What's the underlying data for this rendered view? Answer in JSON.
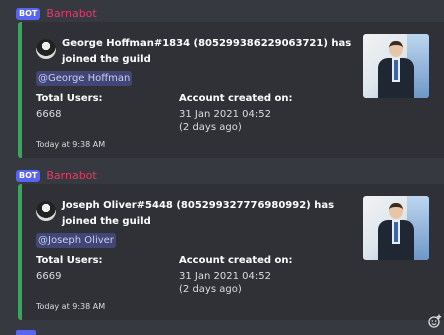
{
  "messages": [
    {
      "bot_tag": "BOT",
      "author": "Barnabot",
      "embed": {
        "title": "George Hoffman#1834 (805299386229063721) has joined the guild",
        "mention": "@George Hoffman",
        "fields": [
          {
            "label": "Total Users:",
            "value": "6668"
          },
          {
            "label": "Account created on:",
            "value_line1": "31 Jan 2021 04:52",
            "value_line2": "(2 days ago)"
          }
        ],
        "footer": "Today at 9:38 AM"
      }
    },
    {
      "bot_tag": "BOT",
      "author": "Barnabot",
      "embed": {
        "title": "Joseph Oliver#5448 (805299327776980992) has joined the guild",
        "mention": "@Joseph Oliver",
        "fields": [
          {
            "label": "Total Users:",
            "value": "6669"
          },
          {
            "label": "Account created on:",
            "value_line1": "31 Jan 2021 04:52",
            "value_line2": "(2 days ago)"
          }
        ],
        "footer": "Today at 9:38 AM"
      }
    }
  ],
  "colors": {
    "background": "#36393f",
    "embed_background": "#2f3136",
    "embed_border": "#3ba55d",
    "author": "#e63a6b",
    "bot_tag": "#5865f2",
    "mention_bg": "#414675"
  },
  "icons": {
    "embed_author_avatar": "user-avatar-icon",
    "thumbnail": "businessman-photo",
    "add_reaction": "add-reaction-icon"
  }
}
